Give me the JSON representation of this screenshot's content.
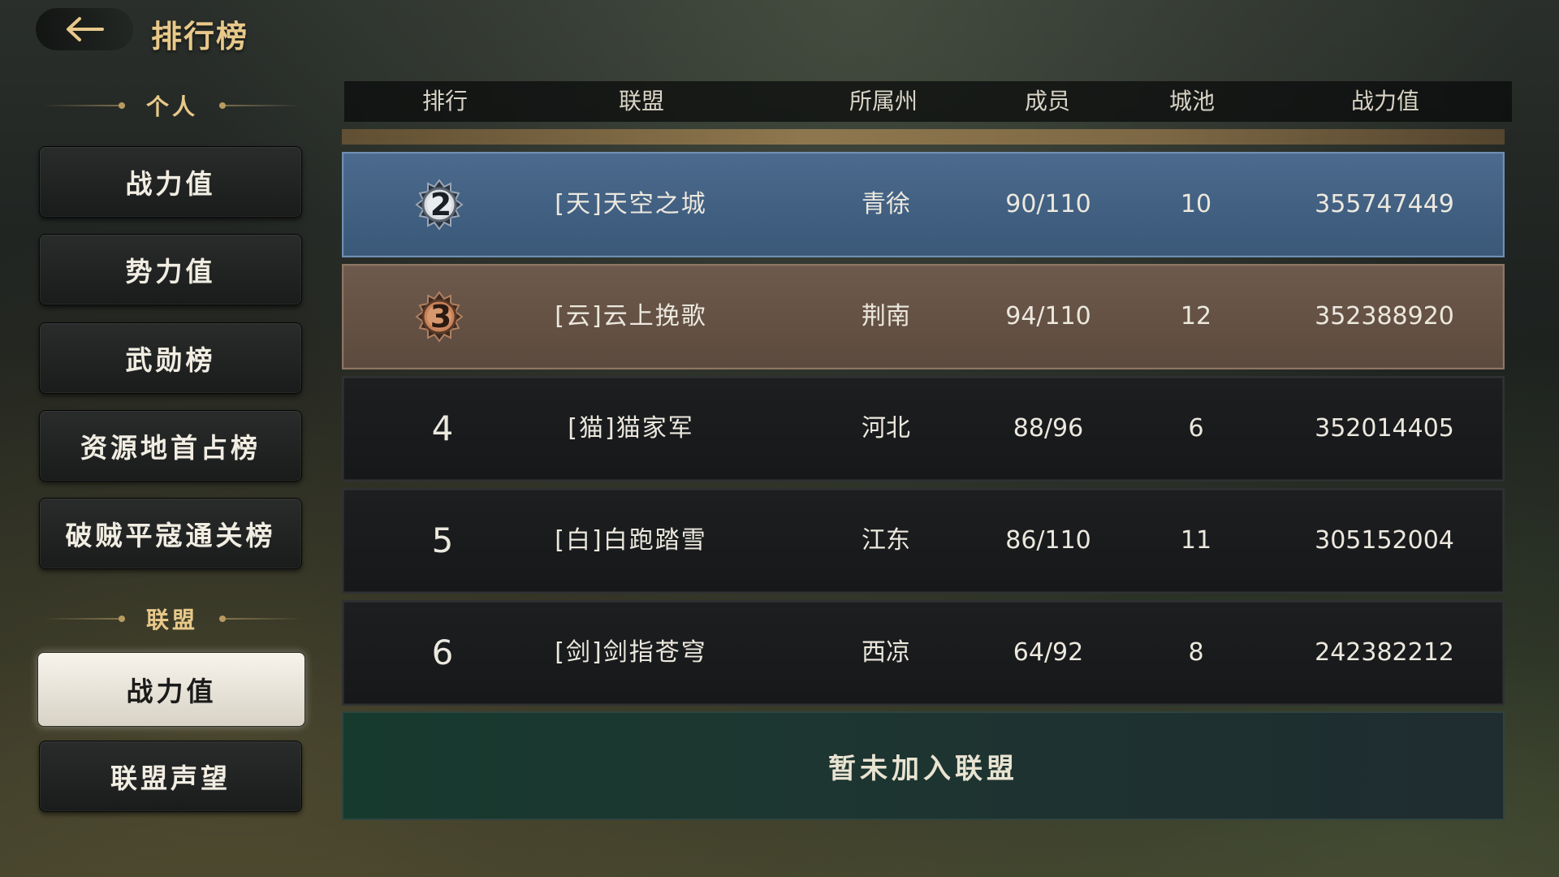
{
  "header": {
    "title": "排行榜"
  },
  "sidebar": {
    "personal_section": "个人",
    "personal_items": [
      "战力值",
      "势力值",
      "武勋榜",
      "资源地首占榜",
      "破贼平寇通关榜"
    ],
    "alliance_section": "联盟",
    "alliance_items": [
      "战力值",
      "联盟声望"
    ],
    "active_item": "alliance.战力值"
  },
  "table": {
    "columns": [
      "排行",
      "联盟",
      "所属州",
      "成员",
      "城池",
      "战力值"
    ],
    "rows": [
      {
        "rank": "2",
        "alliance": "[天]天空之城",
        "state": "青徐",
        "members": "90/110",
        "cities": "10",
        "power": "355747449"
      },
      {
        "rank": "3",
        "alliance": "[云]云上挽歌",
        "state": "荆南",
        "members": "94/110",
        "cities": "12",
        "power": "352388920"
      },
      {
        "rank": "4",
        "alliance": "[猫]猫家军",
        "state": "河北",
        "members": "88/96",
        "cities": "6",
        "power": "352014405"
      },
      {
        "rank": "5",
        "alliance": "[白]白跑踏雪",
        "state": "江东",
        "members": "86/110",
        "cities": "11",
        "power": "305152004"
      },
      {
        "rank": "6",
        "alliance": "[剑]剑指苍穹",
        "state": "西凉",
        "members": "64/92",
        "cities": "8",
        "power": "242382212"
      }
    ],
    "own_status": "暂未加入联盟"
  },
  "colors": {
    "accent_gold": "#e8c98a",
    "rank2_row": "#4b6a8d",
    "rank3_row": "#6e5a4c",
    "normal_row": "#1c1e20",
    "own_row": "#173a2e"
  },
  "icons": {
    "back": "arrow-left-icon",
    "rank2_medal": "silver-medal-icon",
    "rank3_medal": "bronze-medal-icon"
  }
}
